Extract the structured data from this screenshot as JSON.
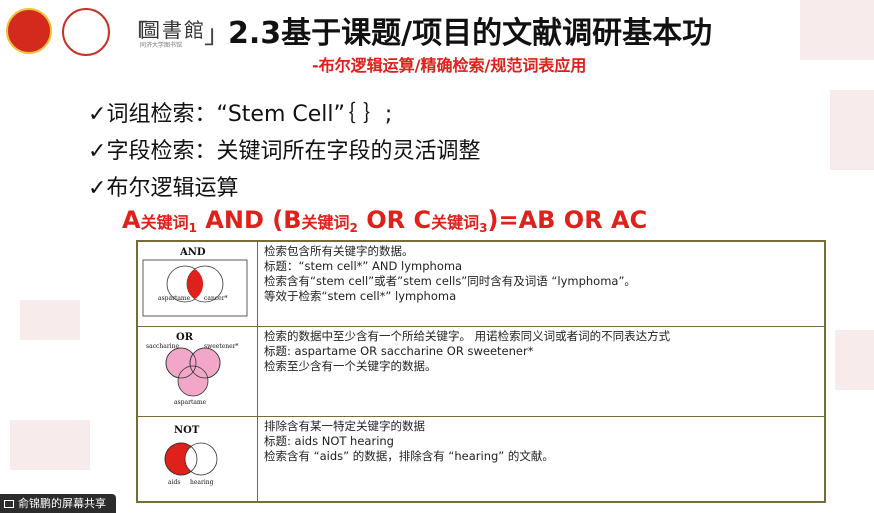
{
  "header": {
    "library_name": "圖書館",
    "library_sub": "同济大学图书馆",
    "title": "2.3基于课题/项目的文献调研基本功",
    "subtitle": "-布尔逻辑运算/精确检索/规范词表应用"
  },
  "bullets": [
    {
      "check": "✓",
      "text": "词组检索：“Stem Cell”｛ ｝;"
    },
    {
      "check": "✓",
      "text": "字段检索：关键词所在字段的灵活调整"
    },
    {
      "check": "✓",
      "text": "布尔逻辑运算"
    }
  ],
  "formula": {
    "a": "A",
    "kw1": "关键词",
    "n1": "1",
    "and": " AND (B",
    "kw2": "关键词",
    "n2": "2",
    "or": " OR C",
    "kw3": "关键词",
    "n3": "3",
    "rest": ")=AB OR AC"
  },
  "operators": [
    {
      "op": "AND",
      "set_a": "aspartame",
      "set_b": "cancer*",
      "lines": [
        "检索包含所有关键字的数据。",
        "标题：“stem cell*” AND lymphoma",
        "检索含有“stem cell”或者”stem cells”同时含有及词语 “lymphoma”。",
        "等效于检索“stem cell*” lymphoma"
      ]
    },
    {
      "op": "OR",
      "set_a": "saccharine",
      "set_b": "sweetener*",
      "set_c": "aspartame",
      "lines": [
        "检索的数据中至少含有一个所给关键字。 用诺检索同义词或者词的不同表达方式",
        "标题: aspartame OR saccharine OR sweetener*",
        "检索至少含有一个关键字的数据。"
      ]
    },
    {
      "op": "NOT",
      "set_a": "aids",
      "set_b": "hearing",
      "lines": [
        "排除含有某一特定关键字的数据",
        "标题: aids NOT hearing",
        "检索含有 “aids” 的数据，排除含有 “hearing” 的文献。"
      ]
    }
  ],
  "share_bar": {
    "label": "俞锦鹏的屏幕共享"
  },
  "colors": {
    "accent_red": "#e0201a",
    "venn_pink": "#f2a6c8",
    "border": "#7a6a3a"
  }
}
